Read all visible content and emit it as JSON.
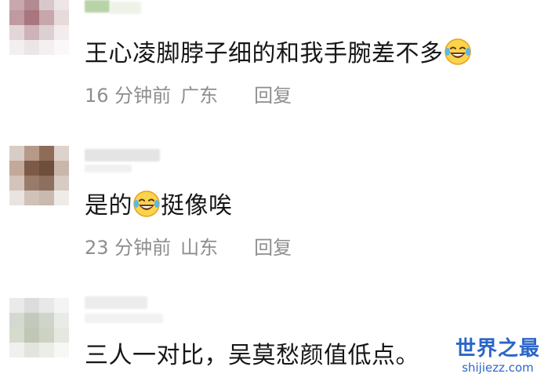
{
  "comments": [
    {
      "text": "王心凌脚脖子细的和我手腕差不多",
      "time": "16 分钟前",
      "location": "广东",
      "reply": "回复",
      "emoji": "laughing-tears"
    },
    {
      "text_before_emoji": "是的",
      "text_after_emoji": "挺像唉",
      "time": "23 分钟前",
      "location": "山东",
      "reply": "回复",
      "emoji": "laughing-tears"
    },
    {
      "text": "三人一对比，吴莫愁颜值低点。"
    }
  ],
  "watermark": {
    "title": "世界之最",
    "url": "shijiezz.com",
    "color": "#2b66c8"
  }
}
